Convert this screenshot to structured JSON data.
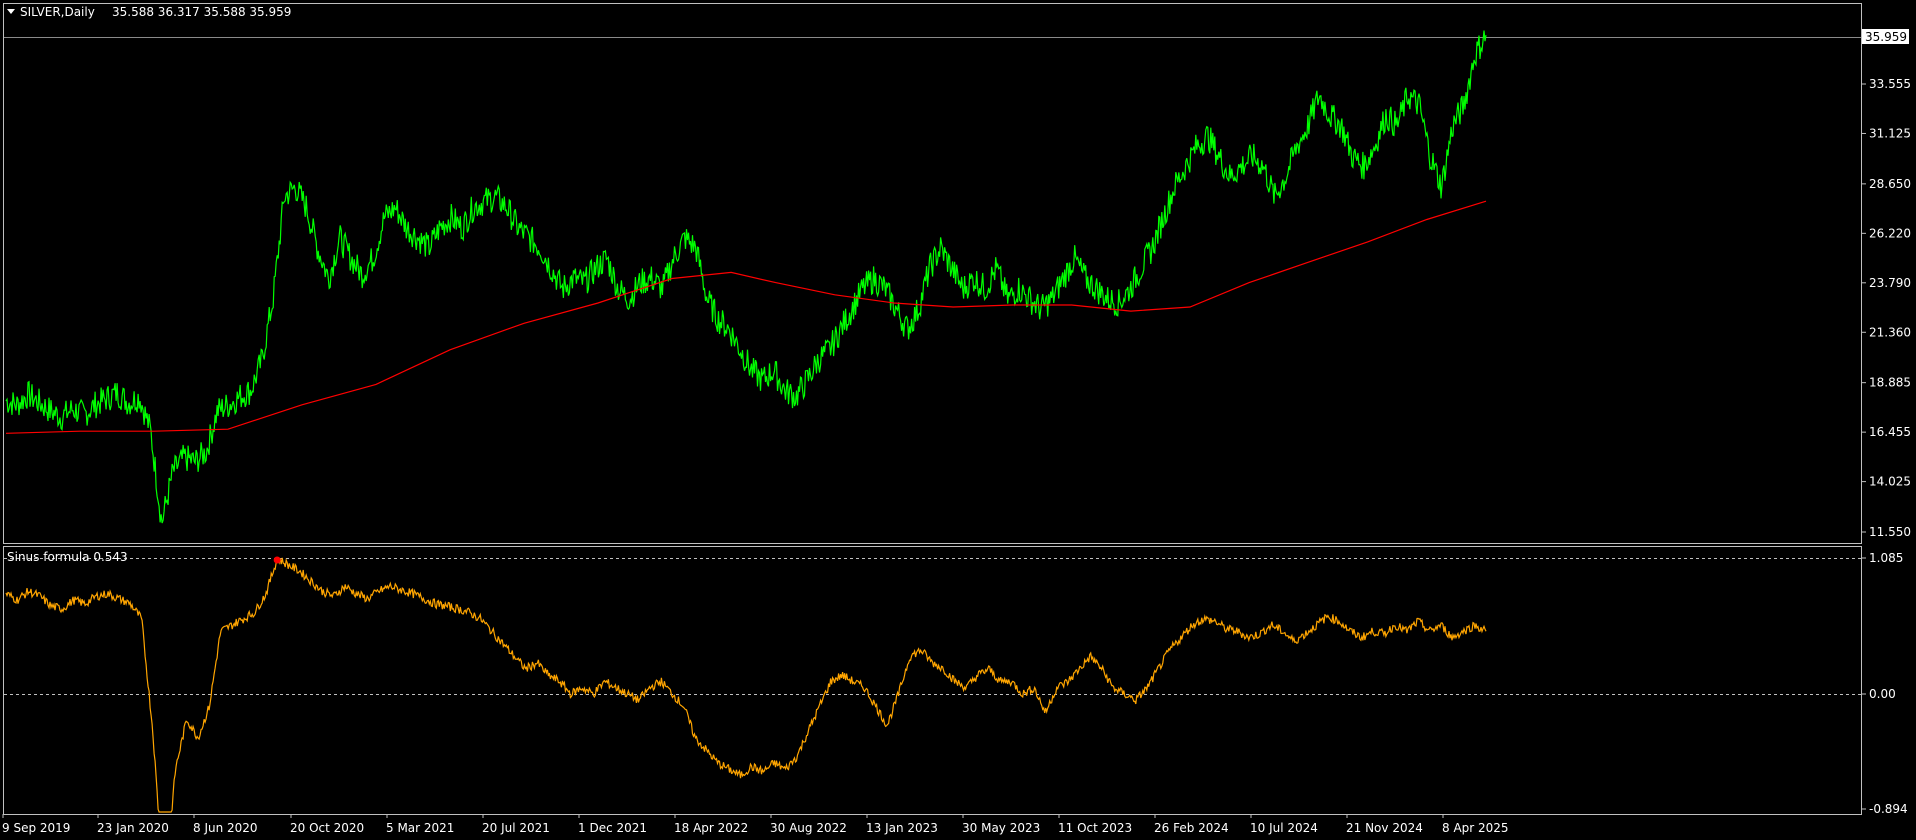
{
  "header": {
    "symbol_label": "SILVER,Daily",
    "ohlc_text": "35.588 36.317 35.588 35.959"
  },
  "indicator": {
    "label": "Sinus formula 0.543"
  },
  "colors": {
    "background": "#000000",
    "frame": "#c0c0c0",
    "price": "#00ff00",
    "ma": "#ff0000",
    "indicator": "#ffa500",
    "marker": "#ff0000",
    "badge_bg": "#ffffff",
    "badge_text": "#000000",
    "dotted": "#c0c0c0"
  },
  "chart_data": [
    {
      "type": "line",
      "name_label": "SILVER,Daily",
      "current_value": "35.959",
      "y_ticks": [
        "33.555",
        "31.125",
        "28.650",
        "26.220",
        "23.790",
        "21.360",
        "18.885",
        "16.455",
        "14.025",
        "11.550"
      ],
      "ylim": [
        10.5,
        37.2
      ],
      "x_ticks": [
        "9 Sep 2019",
        "23 Jan 2020",
        "8 Jun 2020",
        "20 Oct 2020",
        "5 Mar 2021",
        "20 Jul 2021",
        "1 Dec 2021",
        "18 Apr 2022",
        "30 Aug 2022",
        "13 Jan 2023",
        "30 May 2023",
        "11 Oct 2023",
        "26 Feb 2024",
        "10 Jul 2024",
        "21 Nov 2024",
        "8 Apr 2025"
      ],
      "series": [
        {
          "role": "price",
          "color": "#00ff00",
          "values": [
            18.0,
            17.8,
            18.3,
            17.9,
            17.5,
            17.2,
            17.6,
            17.3,
            17.8,
            18.1,
            18.4,
            17.9,
            18.2,
            16.5,
            12.0,
            14.5,
            15.2,
            15.0,
            15.5,
            17.5,
            17.8,
            18.2,
            18.5,
            20.0,
            23.0,
            28.0,
            28.5,
            27.5,
            25.5,
            24.0,
            26.0,
            25.0,
            24.2,
            25.0,
            27.0,
            27.5,
            26.5,
            26.0,
            25.5,
            26.5,
            27.0,
            26.5,
            27.5,
            27.8,
            28.0,
            27.5,
            26.5,
            26.0,
            25.5,
            24.5,
            23.5,
            24.0,
            23.8,
            24.5,
            25.0,
            23.5,
            23.0,
            23.8,
            24.0,
            23.5,
            25.0,
            26.0,
            25.5,
            23.0,
            22.0,
            21.5,
            20.5,
            19.5,
            19.0,
            19.5,
            18.5,
            18.2,
            19.0,
            20.0,
            20.5,
            21.5,
            22.5,
            23.5,
            24.0,
            23.5,
            22.5,
            21.5,
            22.5,
            24.5,
            25.5,
            24.5,
            23.5,
            24.0,
            23.5,
            24.5,
            23.0,
            23.5,
            23.0,
            22.5,
            23.0,
            24.0,
            25.0,
            24.0,
            23.5,
            23.0,
            22.8,
            23.5,
            24.5,
            25.5,
            27.0,
            28.5,
            29.5,
            30.5,
            31.0,
            30.0,
            29.0,
            29.5,
            30.0,
            29.5,
            28.0,
            29.0,
            30.5,
            31.5,
            33.0,
            32.0,
            31.5,
            30.0,
            29.5,
            30.5,
            32.0,
            31.5,
            33.0,
            32.5,
            30.0,
            28.5,
            31.5,
            32.5,
            35.0,
            35.959
          ]
        },
        {
          "role": "moving_average",
          "color": "#ff0000",
          "values": [
            [
              0,
              16.4
            ],
            [
              0.05,
              16.5
            ],
            [
              0.1,
              16.5
            ],
            [
              0.15,
              16.6
            ],
            [
              0.2,
              17.8
            ],
            [
              0.25,
              18.8
            ],
            [
              0.3,
              20.5
            ],
            [
              0.35,
              21.8
            ],
            [
              0.4,
              22.8
            ],
            [
              0.45,
              24.0
            ],
            [
              0.49,
              24.3
            ],
            [
              0.52,
              23.8
            ],
            [
              0.56,
              23.2
            ],
            [
              0.6,
              22.8
            ],
            [
              0.64,
              22.6
            ],
            [
              0.68,
              22.7
            ],
            [
              0.72,
              22.7
            ],
            [
              0.76,
              22.4
            ],
            [
              0.8,
              22.6
            ],
            [
              0.84,
              23.8
            ],
            [
              0.88,
              24.8
            ],
            [
              0.92,
              25.8
            ],
            [
              0.96,
              26.9
            ],
            [
              1.0,
              27.8
            ]
          ]
        }
      ]
    },
    {
      "type": "line",
      "name_label": "Sinus formula 0.543",
      "y_ticks": [
        "1.085",
        "0.00",
        "-0.894"
      ],
      "ylim": [
        -0.894,
        1.085
      ],
      "series": [
        {
          "role": "indicator",
          "color": "#ffa500",
          "values": [
            0.8,
            0.75,
            0.82,
            0.78,
            0.7,
            0.68,
            0.75,
            0.72,
            0.78,
            0.8,
            0.76,
            0.72,
            0.6,
            -0.3,
            -1.6,
            -0.6,
            -0.2,
            -0.35,
            -0.1,
            0.5,
            0.55,
            0.6,
            0.65,
            0.8,
            1.08,
            1.03,
            0.98,
            0.9,
            0.82,
            0.78,
            0.86,
            0.8,
            0.76,
            0.82,
            0.86,
            0.83,
            0.8,
            0.76,
            0.72,
            0.7,
            0.68,
            0.65,
            0.6,
            0.5,
            0.4,
            0.3,
            0.2,
            0.25,
            0.15,
            0.1,
            0.0,
            0.05,
            0.0,
            0.1,
            0.05,
            0.0,
            -0.05,
            0.05,
            0.1,
            0.0,
            -0.1,
            -0.35,
            -0.45,
            -0.55,
            -0.6,
            -0.65,
            -0.58,
            -0.62,
            -0.55,
            -0.6,
            -0.5,
            -0.3,
            -0.1,
            0.1,
            0.15,
            0.1,
            0.05,
            -0.1,
            -0.25,
            0.0,
            0.3,
            0.35,
            0.25,
            0.2,
            0.1,
            0.05,
            0.15,
            0.2,
            0.1,
            0.1,
            0.0,
            0.05,
            -0.15,
            0.05,
            0.1,
            0.2,
            0.3,
            0.2,
            0.05,
            0.0,
            -0.05,
            0.05,
            0.2,
            0.35,
            0.45,
            0.55,
            0.6,
            0.58,
            0.52,
            0.5,
            0.45,
            0.48,
            0.55,
            0.5,
            0.42,
            0.48,
            0.55,
            0.62,
            0.58,
            0.5,
            0.45,
            0.5,
            0.48,
            0.55,
            0.5,
            0.58,
            0.5,
            0.55,
            0.45,
            0.5,
            0.55,
            0.5
          ]
        }
      ]
    }
  ]
}
